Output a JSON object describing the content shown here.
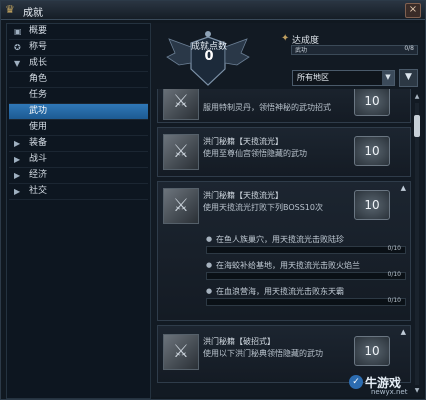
{
  "window": {
    "title": "成就",
    "close_label": "×"
  },
  "sidebar": {
    "items": [
      {
        "label": "概要",
        "icon": "▣"
      },
      {
        "label": "称号",
        "icon": "✪"
      },
      {
        "label": "成长",
        "icon": "▼"
      },
      {
        "label": "角色",
        "icon": ""
      },
      {
        "label": "任务",
        "icon": ""
      },
      {
        "label": "武功",
        "icon": ""
      },
      {
        "label": "使用",
        "icon": ""
      },
      {
        "label": "装备",
        "icon": "▶"
      },
      {
        "label": "战斗",
        "icon": "▶"
      },
      {
        "label": "经济",
        "icon": "▶"
      },
      {
        "label": "社交",
        "icon": "▶"
      }
    ],
    "selected": "武功"
  },
  "summary": {
    "badge_title": "成就点数",
    "badge_value": "0",
    "progress_label": "达成度",
    "bar_name": "武功",
    "bar_value": "0/8"
  },
  "filters": {
    "region": "所有地区",
    "dropdown_arrow": "▼",
    "filter_icon": "▼"
  },
  "achievements": [
    {
      "name": "",
      "desc": "服用特制灵丹，领悟神秘的武功招式",
      "points": "10"
    },
    {
      "name": "洪门秘籍【天揽流光】",
      "desc": "使用至尊仙宫领悟隐藏的武功",
      "points": "10"
    },
    {
      "name": "洪门秘籍【天揽流光】",
      "desc": "使用天揽流光打败下列BOSS10次",
      "points": "10",
      "subs": [
        {
          "text": "在鱼人族巢穴，用天揽流光击败陆珍",
          "value": "0/10",
          "progress": 0
        },
        {
          "text": "在海蛟补给基地，用天揽流光击败火焰兰",
          "value": "0/10",
          "progress": 0
        },
        {
          "text": "在血浪营海，用天揽流光击败东天霸",
          "value": "0/10",
          "progress": 0
        }
      ]
    },
    {
      "name": "洪门秘籍【破招式】",
      "desc": "使用以下洪门秘典领悟隐藏的武功",
      "points": "10"
    }
  ],
  "watermark": {
    "main": "牛游戏",
    "sub": "newyx.net"
  },
  "colors": {
    "accent": "#2f78b8",
    "background": "#121a23",
    "text": "#c9d3dc"
  }
}
